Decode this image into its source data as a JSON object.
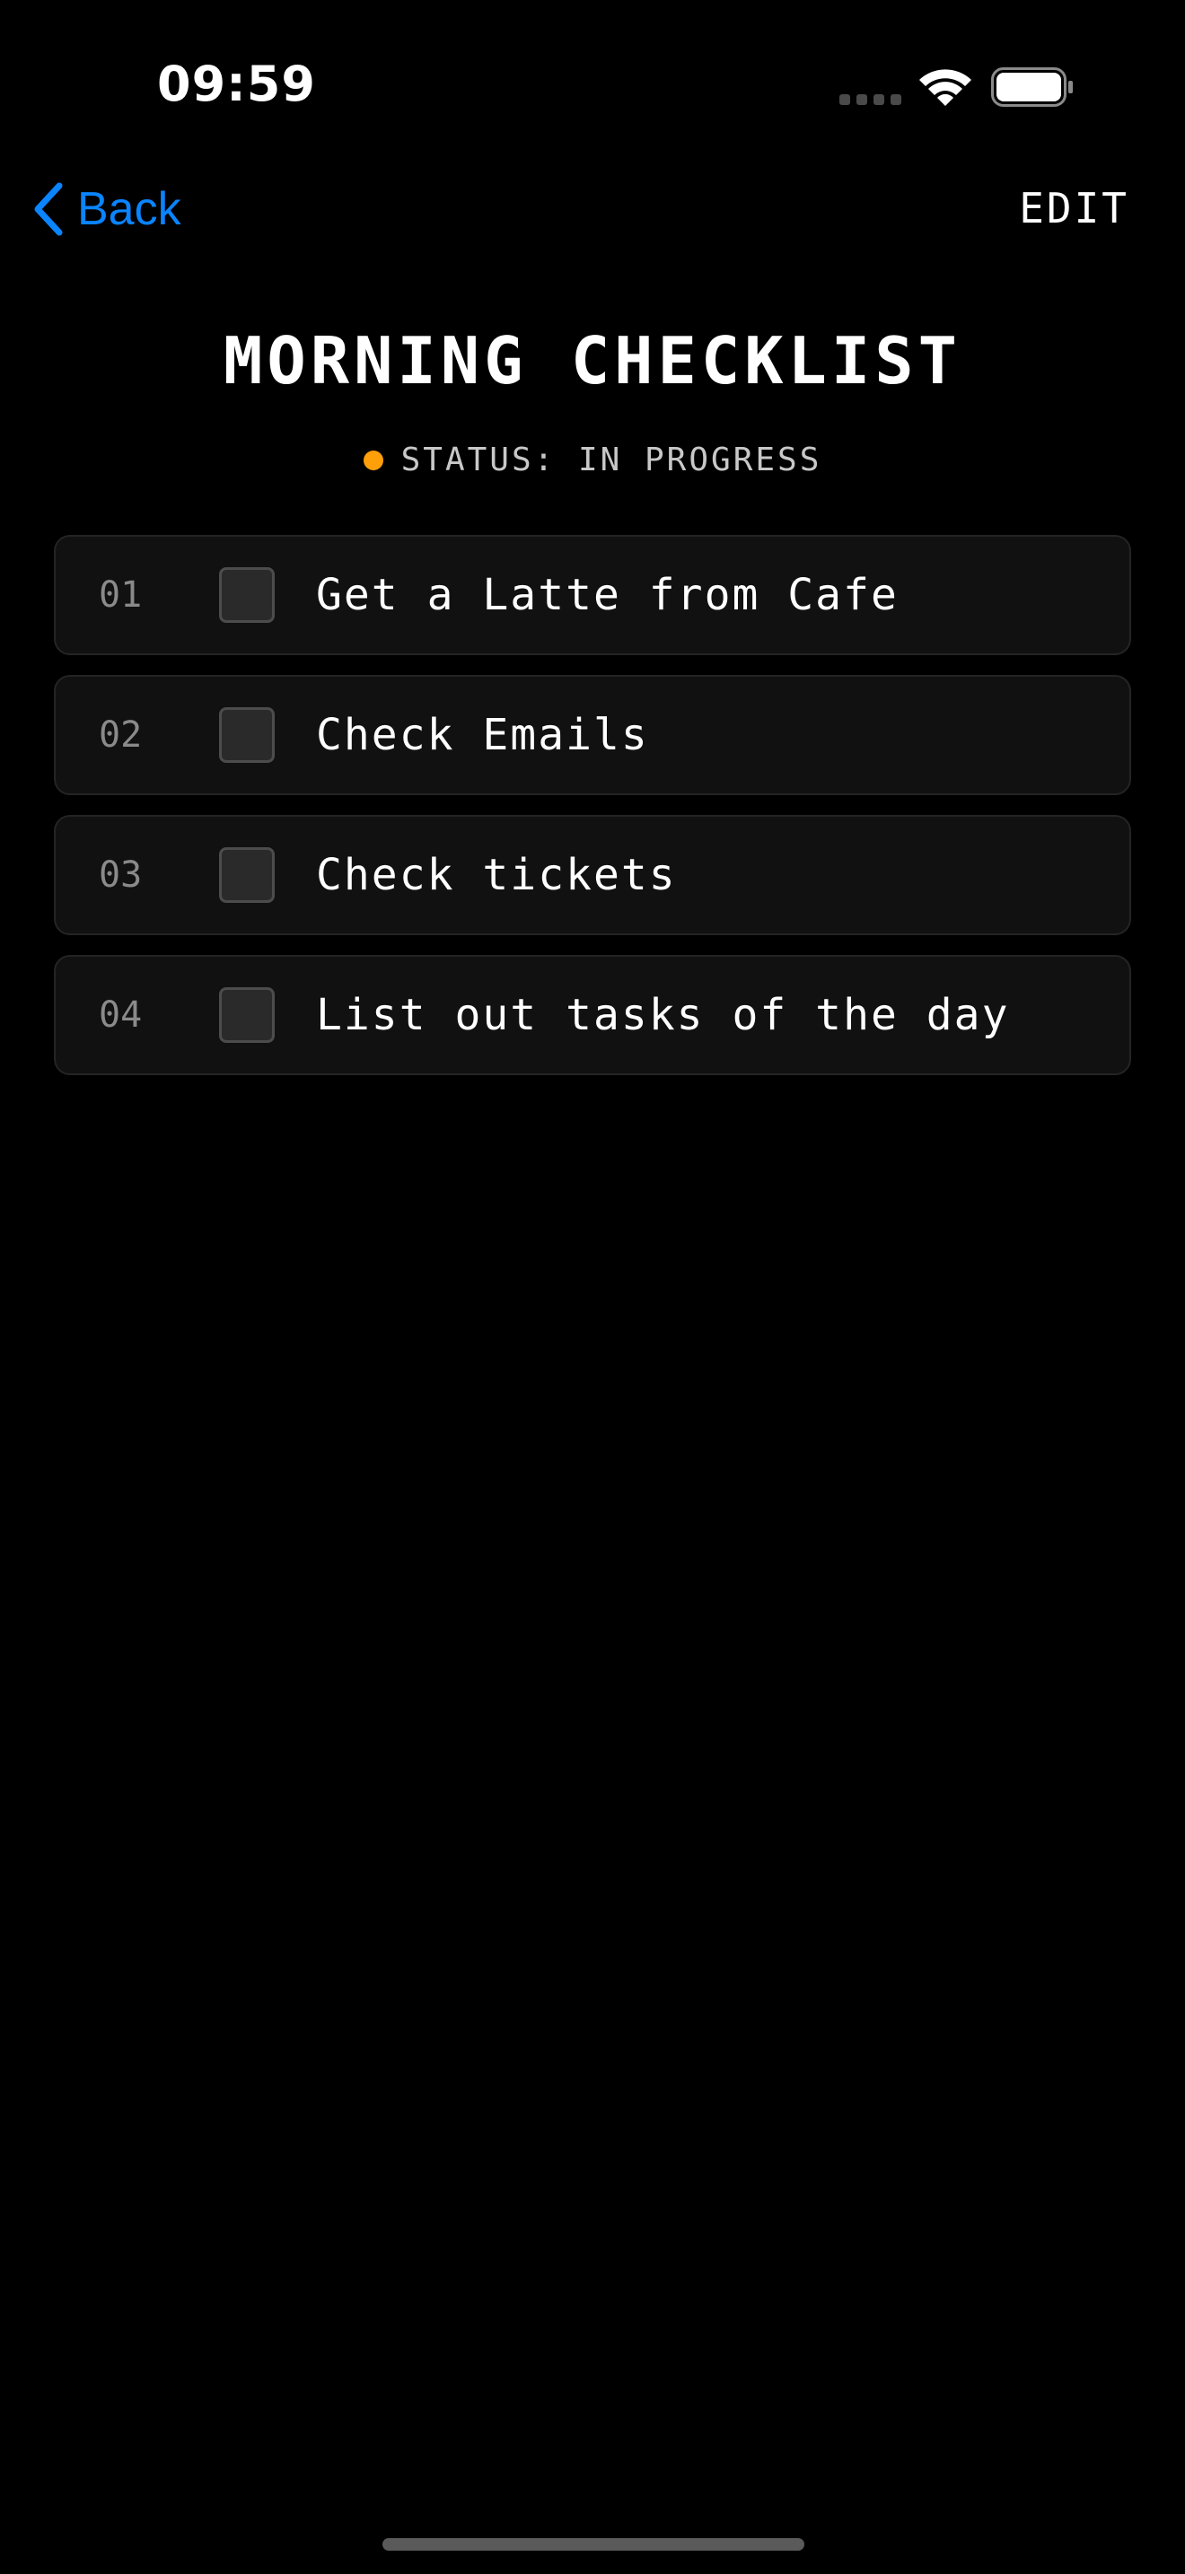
{
  "status_bar": {
    "time": "09:59",
    "signal_icon": "signal-icon",
    "wifi_icon": "wifi-icon",
    "battery_icon": "battery-icon"
  },
  "nav": {
    "back_label": "Back",
    "back_icon": "chevron-left-icon",
    "edit_label": "EDIT",
    "accent_color": "#0a84ff"
  },
  "page": {
    "title": "MORNING CHECKLIST",
    "status_text": "STATUS: IN PROGRESS",
    "status_color": "#ff9f0a"
  },
  "checklist": {
    "items": [
      {
        "number": "01",
        "label": "Get a Latte from Cafe",
        "checked": false
      },
      {
        "number": "02",
        "label": "Check Emails",
        "checked": false
      },
      {
        "number": "03",
        "label": "Check tickets",
        "checked": false
      },
      {
        "number": "04",
        "label": "List out tasks of the day",
        "checked": false
      }
    ]
  }
}
